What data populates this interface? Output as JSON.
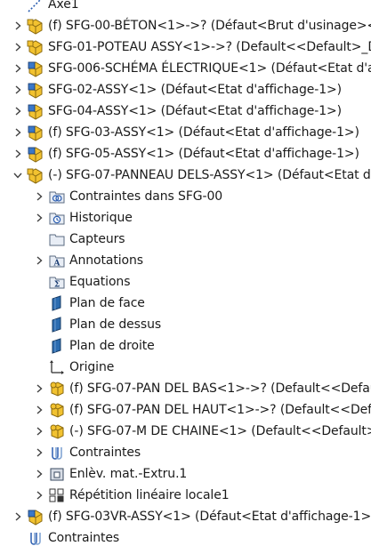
{
  "tree": {
    "items": [
      {
        "label": "Axe1",
        "icon": "axis-icon",
        "expander": "none"
      },
      {
        "label": "(f) SFG-00-BÉTON<1>->? (Défaut<Brut d'usinage><<B",
        "icon": "assembly-yellow-icon",
        "expander": "collapsed"
      },
      {
        "label": "SFG-01-POTEAU ASSY<1>->? (Default<<Default>_Disp",
        "icon": "assembly-yellow-icon",
        "expander": "collapsed"
      },
      {
        "label": "SFG-006-SCHÉMA ÉLECTRIQUE<1> (Défaut<Etat d'affi",
        "icon": "assembly-blue-icon",
        "expander": "collapsed"
      },
      {
        "label": "SFG-02-ASSY<1> (Défaut<Etat d'affichage-1>)",
        "icon": "assembly-blue-icon",
        "expander": "collapsed"
      },
      {
        "label": "SFG-04-ASSY<1> (Défaut<Etat d'affichage-1>)",
        "icon": "assembly-blue-icon",
        "expander": "collapsed"
      },
      {
        "label": "(f) SFG-03-ASSY<1> (Défaut<Etat d'affichage-1>)",
        "icon": "assembly-blue-icon",
        "expander": "collapsed"
      },
      {
        "label": "(f) SFG-05-ASSY<1> (Défaut<Etat d'affichage-1>)",
        "icon": "assembly-blue-icon",
        "expander": "collapsed"
      },
      {
        "label": "(-) SFG-07-PANNEAU DELS-ASSY<1> (Défaut<Etat d'af",
        "icon": "assembly-yellow-icon",
        "expander": "expanded"
      },
      {
        "label": "Contraintes dans SFG-00",
        "icon": "mates-folder-icon",
        "expander": "collapsed"
      },
      {
        "label": "Historique",
        "icon": "history-icon",
        "expander": "collapsed"
      },
      {
        "label": "Capteurs",
        "icon": "sensor-folder-icon",
        "expander": "none"
      },
      {
        "label": "Annotations",
        "icon": "annotations-icon",
        "expander": "collapsed"
      },
      {
        "label": "Equations",
        "icon": "equations-icon",
        "expander": "none"
      },
      {
        "label": "Plan de face",
        "icon": "plane-icon",
        "expander": "none"
      },
      {
        "label": "Plan de dessus",
        "icon": "plane-icon",
        "expander": "none"
      },
      {
        "label": "Plan de droite",
        "icon": "plane-icon",
        "expander": "none"
      },
      {
        "label": "Origine",
        "icon": "origin-icon",
        "expander": "none"
      },
      {
        "label": "(f) SFG-07-PAN DEL BAS<1>->? (Default<<Default",
        "icon": "part-yellow-icon",
        "expander": "collapsed"
      },
      {
        "label": "(f) SFG-07-PAN DEL HAUT<1>->? (Default<<Defau",
        "icon": "part-yellow-icon",
        "expander": "collapsed"
      },
      {
        "label": "(-) SFG-07-M DE CHAINE<1> (Default<<Default>_",
        "icon": "part-yellow-icon",
        "expander": "collapsed"
      },
      {
        "label": "Contraintes",
        "icon": "mates-icon",
        "expander": "collapsed"
      },
      {
        "label": "Enlèv. mat.-Extru.1",
        "icon": "cut-extrude-icon",
        "expander": "collapsed"
      },
      {
        "label": "Répétition linéaire locale1",
        "icon": "linear-pattern-icon",
        "expander": "collapsed"
      },
      {
        "label": "(f) SFG-03VR-ASSY<1> (Défaut<Etat d'affichage-1>)",
        "icon": "assembly-blue-icon",
        "expander": "collapsed"
      },
      {
        "label": "Contraintes",
        "icon": "mates-icon",
        "expander": "none"
      }
    ]
  },
  "colors": {
    "assembly_yellow": "#f2c230",
    "assembly_blue": "#3a78c8",
    "plane_blue": "#2b6cb0",
    "text": "#1a1a1a",
    "expander": "#404040"
  }
}
